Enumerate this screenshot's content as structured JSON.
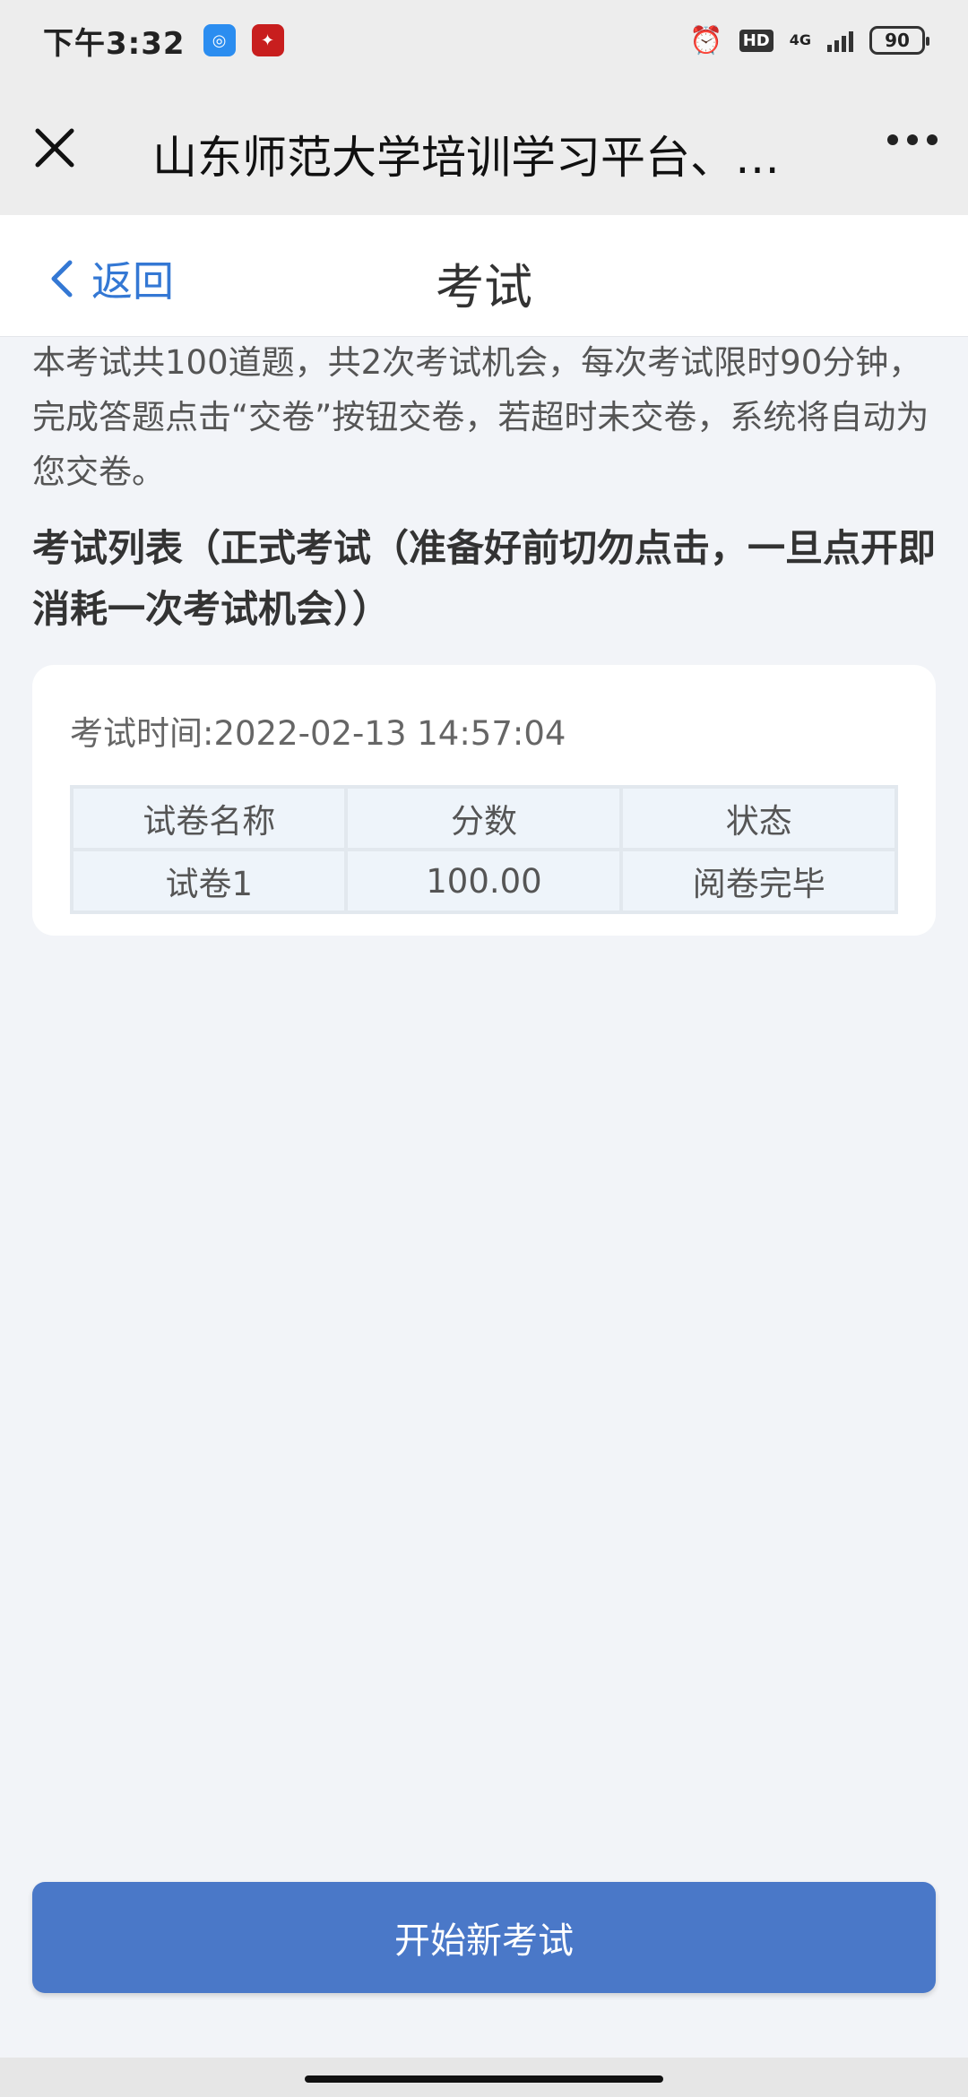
{
  "status_bar": {
    "time": "下午3:32",
    "app_icons": [
      "app-blue-icon",
      "app-red-icon"
    ],
    "hd": "HD",
    "network": "4G",
    "battery": "90"
  },
  "webview": {
    "title": "山东师范大学培训学习平台、…",
    "icons": {
      "close": "close-icon",
      "more": "more-icon"
    }
  },
  "header": {
    "back_label": "返回",
    "title": "考试"
  },
  "intro_text": "本考试共100道题，共2次考试机会，每次考试限时90分钟，完成答题点击“交卷”按钮交卷，若超时未交卷，系统将自动为您交卷。",
  "list_title": "考试列表（正式考试（准备好前切勿点击，一旦点开即消耗一次考试机会））",
  "exam": {
    "time_label": "考试时间:2022-02-13 14:57:04",
    "columns": [
      "试卷名称",
      "分数",
      "状态"
    ],
    "rows": [
      [
        "试卷1",
        "100.00",
        "阅卷完毕"
      ]
    ]
  },
  "start_button": "开始新考试",
  "colors": {
    "accent": "#3478d4",
    "button": "#4a78c8",
    "background": "#f2f4f8"
  }
}
